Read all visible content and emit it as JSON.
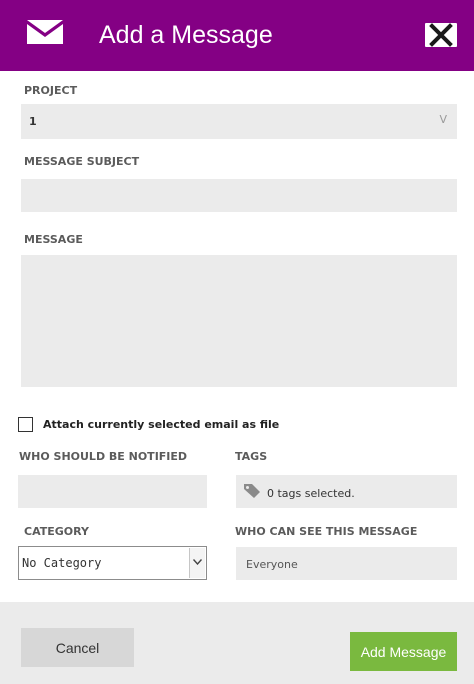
{
  "header": {
    "title": "Add a Message",
    "icon": "mail-icon",
    "close_icon": "close-icon",
    "background": "#840084"
  },
  "form": {
    "project_label": "PROJECT",
    "project_value": "1",
    "project_chevron": "V",
    "subject_label": "MESSAGE SUBJECT",
    "subject_value": "",
    "message_label": "MESSAGE",
    "message_value": "",
    "attach_label": "Attach currently selected email as file",
    "attach_checked": false,
    "notify_label": "WHO SHOULD BE NOTIFIED",
    "notify_value": "",
    "tags_label": "TAGS",
    "tags_icon": "tag-icon",
    "tags_value": "0 tags selected.",
    "category_label": "CATEGORY",
    "category_value": "No Category",
    "visibility_label": "WHO CAN SEE THIS MESSAGE",
    "visibility_value": "Everyone"
  },
  "footer": {
    "cancel_label": "Cancel",
    "add_label": "Add Message",
    "add_color": "#7ab93f"
  }
}
